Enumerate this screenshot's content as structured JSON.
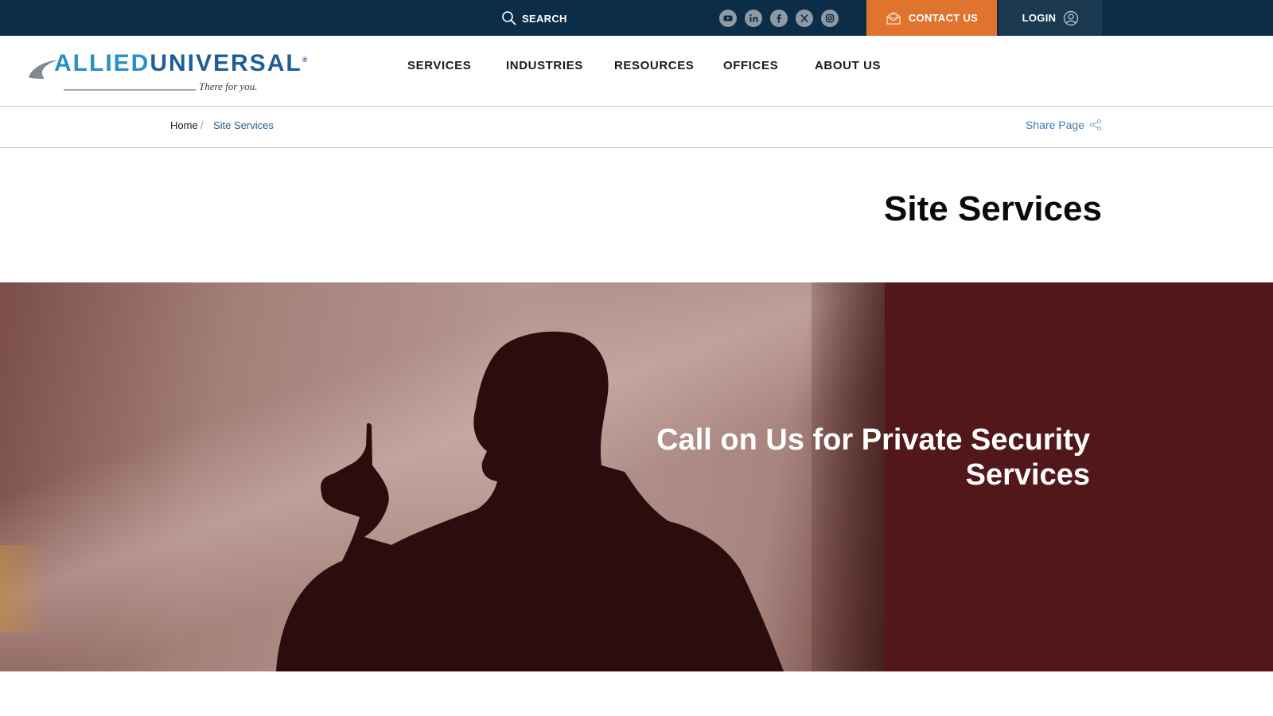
{
  "topbar": {
    "search_label": "SEARCH",
    "socials": [
      "youtube-icon",
      "linkedin-icon",
      "facebook-icon",
      "x-icon",
      "instagram-icon"
    ],
    "contact_label": "CONTACT US",
    "login_label": "LOGIN"
  },
  "brand": {
    "logo_allied": "ALLIED",
    "logo_universal": "UNIVERSAL",
    "logo_registered": "®",
    "tagline": "There for you."
  },
  "nav": {
    "items": [
      {
        "label": "SERVICES"
      },
      {
        "label": "INDUSTRIES"
      },
      {
        "label": "RESOURCES"
      },
      {
        "label": "OFFICES"
      },
      {
        "label": "ABOUT US"
      }
    ]
  },
  "breadcrumb": {
    "home": "Home",
    "separator": "/",
    "current": "Site Services"
  },
  "share": {
    "label": "Share Page"
  },
  "page": {
    "title": "Site Services"
  },
  "hero": {
    "heading": "Call on Us for Private Security Services"
  },
  "colors": {
    "topbar": "#0b2d48",
    "contact": "#e0742f",
    "login": "#1b3a52",
    "hero_panel": "#521819",
    "link": "#3b7bb1"
  }
}
